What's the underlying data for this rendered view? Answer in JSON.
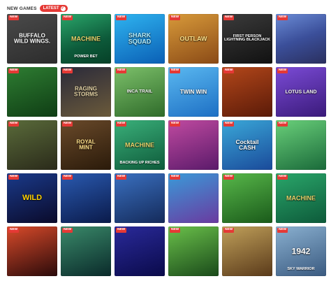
{
  "header": {
    "new_games_label": "NEW GAMES",
    "latest_label": "LATEST",
    "latest_icon": "info-icon"
  },
  "games": [
    {
      "title": "BUFFALO\nWILD WINGS.",
      "sub": "",
      "badge": "NEW",
      "bg": "linear-gradient(160deg,#4a4a4a,#2c2c2c)",
      "color": "#ffffff",
      "size": "8px"
    },
    {
      "title": "MACHINE",
      "sub": "POWER BET",
      "badge": "NEW",
      "bg": "linear-gradient(160deg,#2aa66a,#0d5a3a 60%,#064027)",
      "color": "#e8d36b",
      "size": "9px"
    },
    {
      "title": "SHARK\nSQUAD",
      "sub": "",
      "badge": "NEW",
      "bg": "linear-gradient(160deg,#2fb4f0,#0a5fb5)",
      "color": "#b8f0ff",
      "size": "9px"
    },
    {
      "title": "OUTLAW",
      "sub": "",
      "badge": "NEW",
      "bg": "linear-gradient(160deg,#d89a3a,#8a4a16)",
      "color": "#ffe28a",
      "size": "9px"
    },
    {
      "title": "FIRST PERSON\nLIGHTNING BLACKJACK",
      "sub": "",
      "badge": "NEW",
      "bg": "linear-gradient(160deg,#3b3b3b,#111)",
      "color": "#ffffff",
      "size": "5.5px"
    },
    {
      "title": "",
      "sub": "",
      "badge": "NEW",
      "bg": "linear-gradient(160deg,#6b8cd6,#3b4f9a 50%,#2a2f5e)",
      "color": "#ffffff",
      "size": "7px"
    },
    {
      "title": "",
      "sub": "",
      "badge": "NEW",
      "bg": "linear-gradient(160deg,#2e7d32,#0f3d14)",
      "color": "#ffdf3a",
      "size": "7px"
    },
    {
      "title": "RAGING\nSTORMS",
      "sub": "",
      "badge": "NEW",
      "bg": "linear-gradient(160deg,#2a2a3a,#6b5a3a)",
      "color": "#e8d7a8",
      "size": "8px"
    },
    {
      "title": "INCA TRAIL",
      "sub": "",
      "badge": "NEW",
      "bg": "linear-gradient(160deg,#7cc06a,#2f6b2a)",
      "color": "#ffffff",
      "size": "6.5px"
    },
    {
      "title": "TWIN WIN",
      "sub": "",
      "badge": "NEW",
      "bg": "linear-gradient(160deg,#5ab8f0,#1d6fc4)",
      "color": "#ffffff",
      "size": "8px"
    },
    {
      "title": "",
      "sub": "",
      "badge": "NEW",
      "bg": "linear-gradient(160deg,#b3471a,#5a1a08)",
      "color": "#ffcf6a",
      "size": "7px"
    },
    {
      "title": "LOTUS LAND",
      "sub": "",
      "badge": "NEW",
      "bg": "linear-gradient(160deg,#7b4bd6,#3a1a7a)",
      "color": "#ffffff",
      "size": "7px"
    },
    {
      "title": "",
      "sub": "",
      "badge": "NEW",
      "bg": "linear-gradient(160deg,#5a6b3a,#2a2a1a)",
      "color": "#ffd24a",
      "size": "7px"
    },
    {
      "title": "ROYAL\nMINT",
      "sub": "",
      "badge": "NEW",
      "bg": "linear-gradient(160deg,#6a4a2a,#2a1a0a)",
      "color": "#ffe08a",
      "size": "8px"
    },
    {
      "title": "MACHINE",
      "sub": "BACKING UP RICHES",
      "badge": "NEW",
      "bg": "linear-gradient(160deg,#3ab07a,#0e5a3a)",
      "color": "#e8d36b",
      "size": "9px"
    },
    {
      "title": "",
      "sub": "",
      "badge": "NEW",
      "bg": "linear-gradient(160deg,#c04aa0,#5a1a6a)",
      "color": "#ffdf3a",
      "size": "7px"
    },
    {
      "title": "Cocktail\nCASH",
      "sub": "",
      "badge": "NEW",
      "bg": "linear-gradient(160deg,#3aa8d8,#1a4a9a)",
      "color": "#ffffff",
      "size": "8.5px"
    },
    {
      "title": "",
      "sub": "",
      "badge": "NEW",
      "bg": "linear-gradient(160deg,#6ad07a,#1a6a3a)",
      "color": "#ffe24a",
      "size": "7px"
    },
    {
      "title": "WILD",
      "sub": "",
      "badge": "NEW",
      "bg": "linear-gradient(160deg,#1a3a8a,#0a0a2a)",
      "color": "#ffd000",
      "size": "11px"
    },
    {
      "title": "",
      "sub": "",
      "badge": "NEW",
      "bg": "linear-gradient(160deg,#2a5ab0,#0a1a4a)",
      "color": "#ffe24a",
      "size": "7px"
    },
    {
      "title": "",
      "sub": "",
      "badge": "NEW",
      "bg": "linear-gradient(160deg,#3a70c0,#142a5a)",
      "color": "#ffe08a",
      "size": "6.5px"
    },
    {
      "title": "",
      "sub": "",
      "badge": "NEW",
      "bg": "linear-gradient(160deg,#3a9ad8,#6a3aa0)",
      "color": "#ffe08a",
      "size": "6.5px"
    },
    {
      "title": "",
      "sub": "",
      "badge": "NEW",
      "bg": "linear-gradient(160deg,#58b84a,#1a5a1a)",
      "color": "#ffe24a",
      "size": "7px"
    },
    {
      "title": "MACHINE",
      "sub": "",
      "badge": "NEW",
      "bg": "linear-gradient(160deg,#2aa66a,#0d5a3a)",
      "color": "#e8d36b",
      "size": "9px"
    },
    {
      "title": "",
      "sub": "",
      "badge": "NEW",
      "bg": "linear-gradient(160deg,#d84a2a,#2a0a0a)",
      "color": "#ffffff",
      "size": "7px"
    },
    {
      "title": "",
      "sub": "",
      "badge": "NEW",
      "bg": "linear-gradient(160deg,#3a8a6a,#0a2a2a)",
      "color": "#ffffff",
      "size": "6px"
    },
    {
      "title": "",
      "sub": "",
      "badge": "NEW",
      "bg": "linear-gradient(160deg,#2a2a9a,#0a0a4a)",
      "color": "#ffd04a",
      "size": "6.5px"
    },
    {
      "title": "",
      "sub": "",
      "badge": "NEW",
      "bg": "linear-gradient(160deg,#6ac04a,#1a4a1a)",
      "color": "#ffffff",
      "size": "6.5px"
    },
    {
      "title": "",
      "sub": "",
      "badge": "NEW",
      "bg": "linear-gradient(160deg,#c0a05a,#5a3a1a)",
      "color": "#ffffff",
      "size": "6.5px"
    },
    {
      "title": "1942",
      "sub": "SKY WARRIOR",
      "badge": "NEW",
      "bg": "linear-gradient(160deg,#8ab0d0,#3a5a80)",
      "color": "#ffffff",
      "size": "12px"
    }
  ]
}
